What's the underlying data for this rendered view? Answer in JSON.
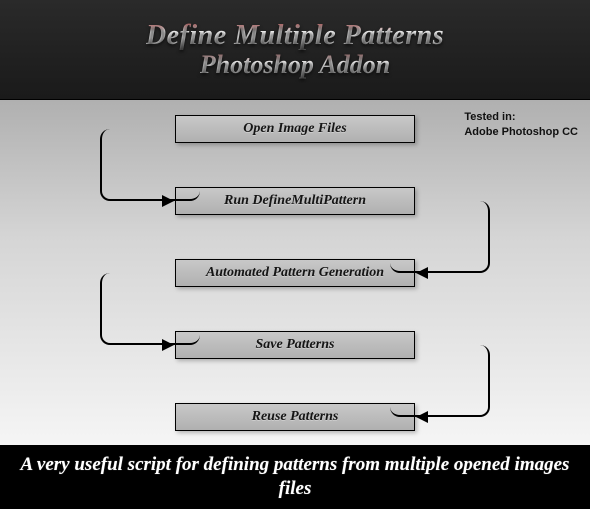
{
  "header": {
    "title_line1": "Define Multiple Patterns",
    "title_line2": "Photoshop Addon"
  },
  "tested": {
    "label": "Tested in:",
    "value": "Adobe Photoshop CC"
  },
  "steps": [
    {
      "label": "Open Image Files"
    },
    {
      "label": "Run DefineMultiPattern"
    },
    {
      "label": "Automated Pattern Generation"
    },
    {
      "label": "Save Patterns"
    },
    {
      "label": "Reuse Patterns"
    }
  ],
  "footer": {
    "text": "A very useful script for defining patterns from multiple opened images files"
  },
  "chart_data": {
    "type": "flow",
    "nodes": [
      "Open Image Files",
      "Run DefineMultiPattern",
      "Automated Pattern Generation",
      "Save Patterns",
      "Reuse Patterns"
    ],
    "edges": [
      {
        "from": 0,
        "to": 1,
        "side": "left"
      },
      {
        "from": 1,
        "to": 2,
        "side": "right"
      },
      {
        "from": 2,
        "to": 3,
        "side": "left"
      },
      {
        "from": 3,
        "to": 4,
        "side": "right"
      }
    ]
  }
}
